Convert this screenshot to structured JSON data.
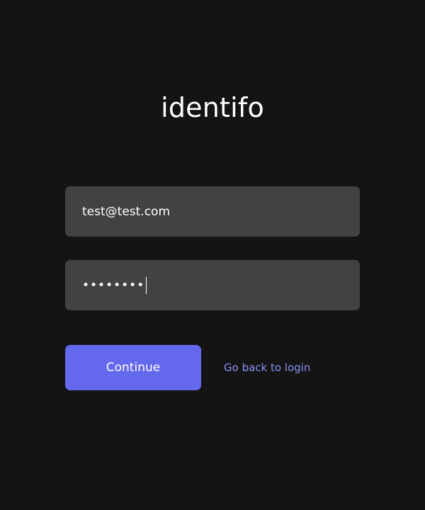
{
  "brand": {
    "logo_text": "identifo"
  },
  "form": {
    "email_value": "test@test.com",
    "password_masked": "••••••••"
  },
  "actions": {
    "continue_label": "Continue",
    "back_label": "Go back to login"
  },
  "colors": {
    "background": "#141414",
    "input_bg": "#434243",
    "accent": "#6368ec",
    "link": "#8a8ef4"
  }
}
